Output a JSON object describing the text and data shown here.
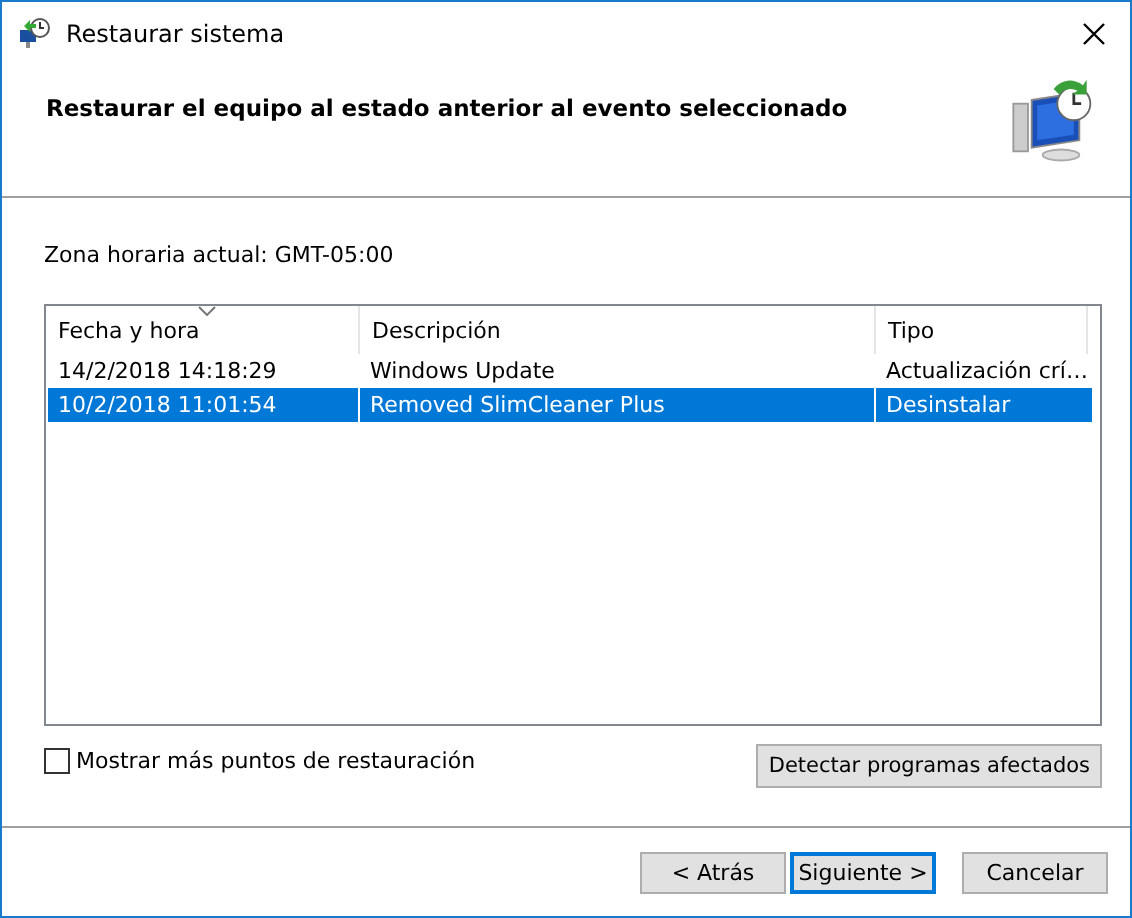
{
  "window": {
    "title": "Restaurar sistema"
  },
  "header": {
    "heading": "Restaurar el equipo al estado anterior al evento seleccionado"
  },
  "timezone": "Zona horaria actual: GMT-05:00",
  "table": {
    "columns": [
      {
        "label": "Fecha y hora",
        "sorted": true
      },
      {
        "label": "Descripción",
        "sorted": false
      },
      {
        "label": "Tipo",
        "sorted": false
      }
    ],
    "rows": [
      {
        "cells": [
          "14/2/2018 14:18:29",
          "Windows Update",
          "Actualización crí…"
        ],
        "selected": false
      },
      {
        "cells": [
          "10/2/2018 11:01:54",
          "Removed SlimCleaner Plus",
          "Desinstalar"
        ],
        "selected": true
      }
    ]
  },
  "show_more": {
    "label": "Mostrar más puntos de restauración",
    "checked": false
  },
  "detect_button": "Detectar programas afectados",
  "buttons": [
    {
      "label": "< Atrás",
      "focused": false
    },
    {
      "label": "Siguiente >",
      "focused": true
    },
    {
      "label": "Cancelar",
      "focused": false
    }
  ]
}
